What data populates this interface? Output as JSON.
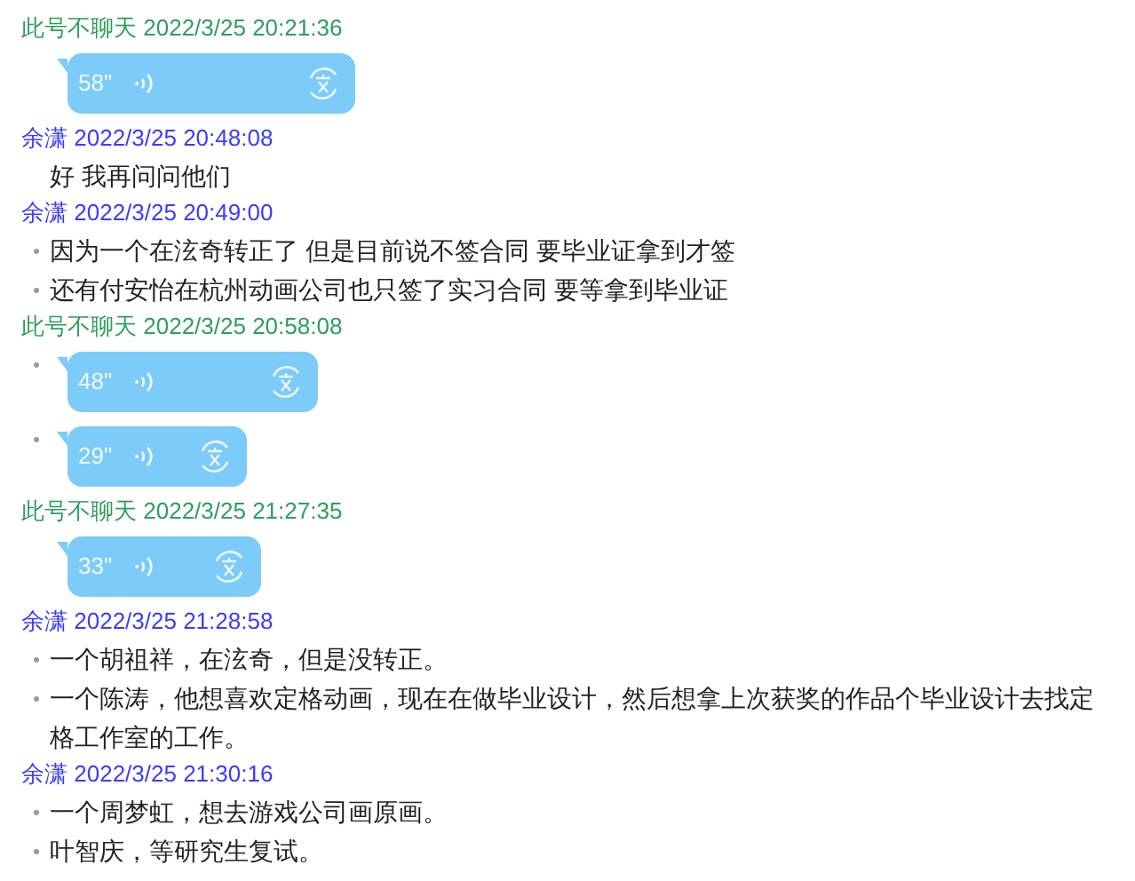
{
  "messages": [
    {
      "sender": "此号不聊天",
      "time": "2022/3/25 20:21:36",
      "color": "#2e9e5b",
      "items": [
        {
          "kind": "voice",
          "bulleted": false,
          "duration": "58\""
        }
      ]
    },
    {
      "sender": "余潇",
      "time": "2022/3/25 20:48:08",
      "color": "#3b3bff",
      "items": [
        {
          "kind": "text",
          "bulleted": false,
          "text": "好 我再问问他们"
        }
      ]
    },
    {
      "sender": "余潇",
      "time": "2022/3/25 20:49:00",
      "color": "#3b3bff",
      "items": [
        {
          "kind": "text",
          "bulleted": true,
          "text": "因为一个在泫奇转正了 但是目前说不签合同 要毕业证拿到才签"
        },
        {
          "kind": "text",
          "bulleted": true,
          "text": "还有付安怡在杭州动画公司也只签了实习合同 要等拿到毕业证"
        }
      ]
    },
    {
      "sender": "此号不聊天",
      "time": "2022/3/25 20:58:08",
      "color": "#2e9e5b",
      "items": [
        {
          "kind": "voice",
          "bulleted": true,
          "duration": "48\""
        },
        {
          "kind": "voice",
          "bulleted": true,
          "duration": "29\""
        }
      ]
    },
    {
      "sender": "此号不聊天",
      "time": "2022/3/25 21:27:35",
      "color": "#2e9e5b",
      "items": [
        {
          "kind": "voice",
          "bulleted": false,
          "duration": "33\""
        }
      ]
    },
    {
      "sender": "余潇",
      "time": "2022/3/25 21:28:58",
      "color": "#3b3bff",
      "items": [
        {
          "kind": "text",
          "bulleted": true,
          "text": "一个胡祖祥，在泫奇，但是没转正。"
        },
        {
          "kind": "text",
          "bulleted": true,
          "text": "一个陈涛，他想喜欢定格动画，现在在做毕业设计，然后想拿上次获奖的作品个毕业设计去找定格工作室的工作。"
        }
      ]
    },
    {
      "sender": "余潇",
      "time": "2022/3/25 21:30:16",
      "color": "#3b3bff",
      "items": [
        {
          "kind": "text",
          "bulleted": true,
          "text": "一个周梦虹，想去游戏公司画原画。"
        },
        {
          "kind": "text",
          "bulleted": true,
          "text": "叶智庆，等研究生复试。"
        }
      ]
    }
  ]
}
